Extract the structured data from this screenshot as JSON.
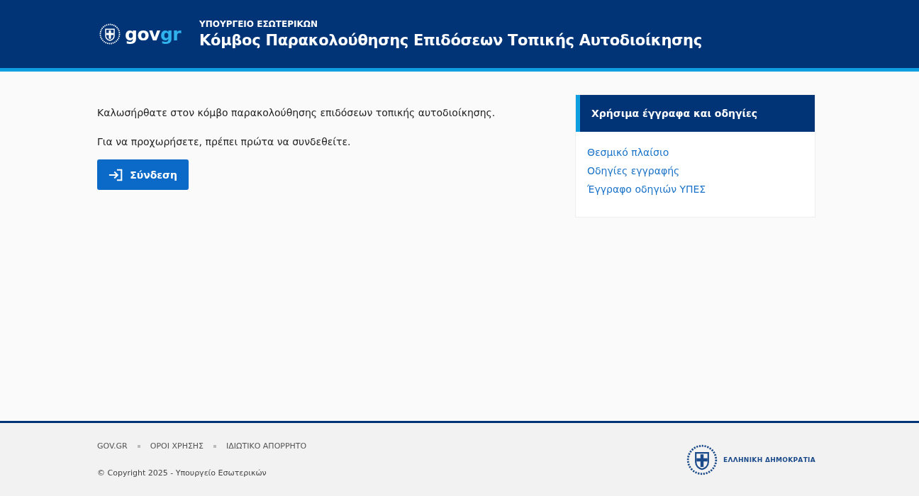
{
  "header": {
    "logo": [
      "gov",
      "gr"
    ],
    "ministry": "ΥΠΟΥΡΓΕΙΟ ΕΣΩΤΕΡΙΚΩΝ",
    "title": "Κόμβος Παρακολούθησης Επιδόσεων Τοπικής Αυτοδιοίκησης"
  },
  "main": {
    "welcome": "Καλωσήρθατε στον κόμβο παρακολούθησης επιδόσεων τοπικής αυτοδιοίκησης.",
    "prompt": "Για να προχωρήσετε, πρέπει πρώτα να συνδεθείτε.",
    "login_button": "Σύνδεση"
  },
  "sidebar": {
    "title": "Χρήσιμα έγγραφα και οδηγίες",
    "links": [
      "Θεσμικό πλαίσιο",
      "Οδηγίες εγγραφής",
      "Έγγραφο οδηγιών ΥΠΕΣ"
    ]
  },
  "footer": {
    "links": [
      "GOV.GR",
      "ΟΡΟΙ ΧΡΗΣΗΣ",
      "ΙΔΙΩΤΙΚΟ ΑΠΟΡΡΗΤΟ"
    ],
    "copyright": "© Copyright 2025 - Υπουργείο Εσωτερικών",
    "emblem_text": "ΕΛΛΗΝΙΚΗ ΔΗΜΟΚΡΑΤΙΑ"
  }
}
